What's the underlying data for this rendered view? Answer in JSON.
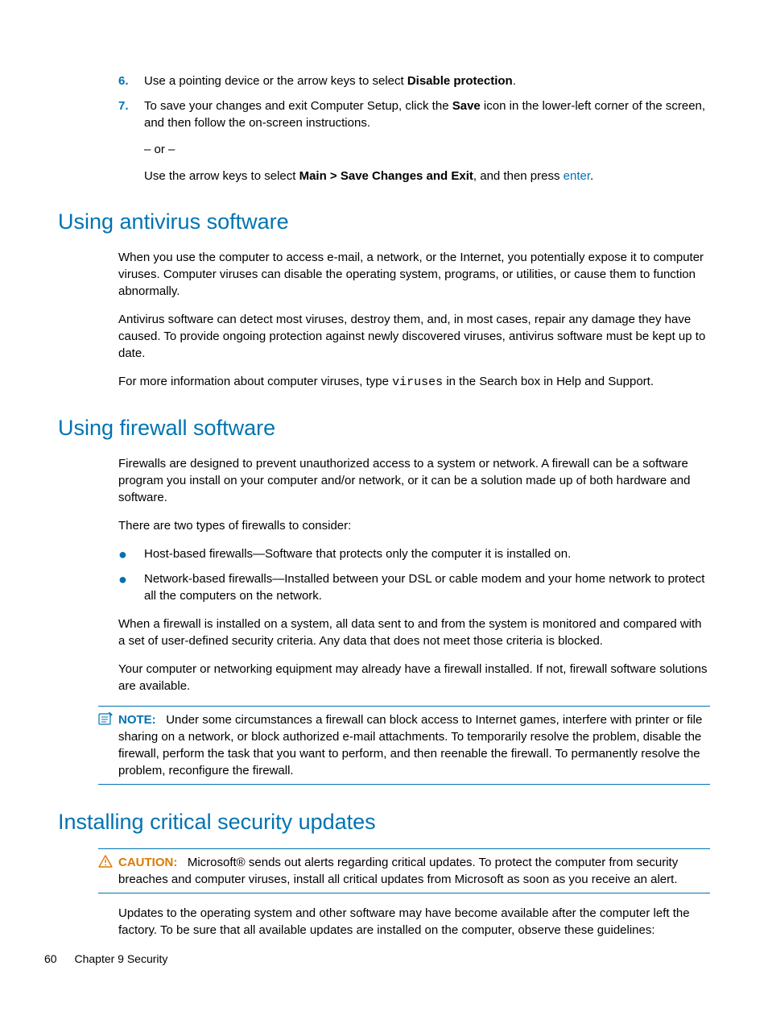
{
  "steps": {
    "six_num": "6.",
    "six_a": "Use a pointing device or the arrow keys to select ",
    "six_b": "Disable protection",
    "six_c": ".",
    "seven_num": "7.",
    "seven_a": "To save your changes and exit Computer Setup, click the ",
    "seven_b": "Save",
    "seven_c": " icon in the lower-left corner of the screen, and then follow the on-screen instructions.",
    "or": "– or –",
    "seven_alt_a": "Use the arrow keys to select ",
    "seven_alt_b": "Main > Save Changes and Exit",
    "seven_alt_c": ", and then press ",
    "seven_alt_d": "enter",
    "seven_alt_e": "."
  },
  "antivirus": {
    "heading": "Using antivirus software",
    "p1": "When you use the computer to access e-mail, a network, or the Internet, you potentially expose it to computer viruses. Computer viruses can disable the operating system, programs, or utilities, or cause them to function abnormally.",
    "p2": "Antivirus software can detect most viruses, destroy them, and, in most cases, repair any damage they have caused. To provide ongoing protection against newly discovered viruses, antivirus software must be kept up to date.",
    "p3a": "For more information about computer viruses, type ",
    "p3b": "viruses",
    "p3c": " in the Search box in Help and Support."
  },
  "firewall": {
    "heading": "Using firewall software",
    "p1": "Firewalls are designed to prevent unauthorized access to a system or network. A firewall can be a software program you install on your computer and/or network, or it can be a solution made up of both hardware and software.",
    "p2": "There are two types of firewalls to consider:",
    "b1": "Host-based firewalls—Software that protects only the computer it is installed on.",
    "b2": "Network-based firewalls—Installed between your DSL or cable modem and your home network to protect all the computers on the network.",
    "p3": "When a firewall is installed on a system, all data sent to and from the system is monitored and compared with a set of user-defined security criteria. Any data that does not meet those criteria is blocked.",
    "p4": "Your computer or networking equipment may already have a firewall installed. If not, firewall software solutions are available.",
    "note_label": "NOTE:",
    "note_body": "Under some circumstances a firewall can block access to Internet games, interfere with printer or file sharing on a network, or block authorized e-mail attachments. To temporarily resolve the problem, disable the firewall, perform the task that you want to perform, and then reenable the firewall. To permanently resolve the problem, reconfigure the firewall."
  },
  "updates": {
    "heading": "Installing critical security updates",
    "caution_label": "CAUTION:",
    "caution_body": "Microsoft® sends out alerts regarding critical updates. To protect the computer from security breaches and computer viruses, install all critical updates from Microsoft as soon as you receive an alert.",
    "p1": "Updates to the operating system and other software may have become available after the computer left the factory. To be sure that all available updates are installed on the computer, observe these guidelines:"
  },
  "footer": {
    "page": "60",
    "chapter": "Chapter 9   Security"
  }
}
